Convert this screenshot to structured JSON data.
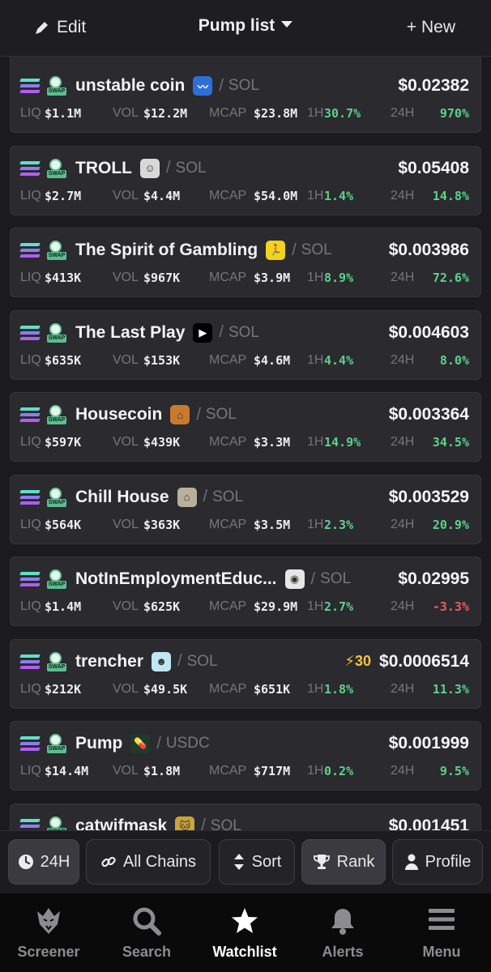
{
  "header": {
    "edit_label": "Edit",
    "title": "Pump list",
    "new_label": "+ New"
  },
  "labels": {
    "liq": "LIQ",
    "vol": "VOL",
    "mcap": "MCAP",
    "h1": "1H",
    "h24": "24H"
  },
  "tokens": [
    {
      "name": "unstable coin",
      "quote": "SOL",
      "price": "$0.02382",
      "liq": "$1.1M",
      "vol": "$12.2M",
      "mcap": "$23.8M",
      "ch1h": "30.7%",
      "ch24h": "970%",
      "logo_bg": "#2d6fd6",
      "logo_glyph": "〰"
    },
    {
      "name": "TROLL",
      "quote": "SOL",
      "price": "$0.05408",
      "liq": "$2.7M",
      "vol": "$4.4M",
      "mcap": "$54.0M",
      "ch1h": "1.4%",
      "ch24h": "14.8%",
      "logo_bg": "#d8d8d8",
      "logo_glyph": "☺"
    },
    {
      "name": "The Spirit of Gambling",
      "quote": "SOL",
      "price": "$0.003986",
      "liq": "$413K",
      "vol": "$967K",
      "mcap": "$3.9M",
      "ch1h": "8.9%",
      "ch24h": "72.6%",
      "logo_bg": "#f3d21a",
      "logo_glyph": "🏃"
    },
    {
      "name": "The Last Play",
      "quote": "SOL",
      "price": "$0.004603",
      "liq": "$635K",
      "vol": "$153K",
      "mcap": "$4.6M",
      "ch1h": "4.4%",
      "ch24h": "8.0%",
      "logo_bg": "#000000",
      "logo_glyph": "▶"
    },
    {
      "name": "Housecoin",
      "quote": "SOL",
      "price": "$0.003364",
      "liq": "$597K",
      "vol": "$439K",
      "mcap": "$3.3M",
      "ch1h": "14.9%",
      "ch24h": "34.5%",
      "logo_bg": "#c97a2e",
      "logo_glyph": "⌂"
    },
    {
      "name": "Chill House",
      "quote": "SOL",
      "price": "$0.003529",
      "liq": "$564K",
      "vol": "$363K",
      "mcap": "$3.5M",
      "ch1h": "2.3%",
      "ch24h": "20.9%",
      "logo_bg": "#b8b09a",
      "logo_glyph": "⌂"
    },
    {
      "name": "NotInEmploymentEduc...",
      "quote": "SOL",
      "price": "$0.02995",
      "liq": "$1.4M",
      "vol": "$625K",
      "mcap": "$29.9M",
      "ch1h": "2.7%",
      "ch24h": "-3.3%",
      "logo_bg": "#e6e6e6",
      "logo_glyph": "◉"
    },
    {
      "name": "trencher",
      "quote": "SOL",
      "price": "$0.0006514",
      "liq": "$212K",
      "vol": "$49.5K",
      "mcap": "$651K",
      "ch1h": "1.8%",
      "ch24h": "11.3%",
      "logo_bg": "#bfe6f5",
      "logo_glyph": "☻",
      "boost": "⚡30"
    },
    {
      "name": "Pump",
      "quote": "USDC",
      "price": "$0.001999",
      "liq": "$14.4M",
      "vol": "$1.8M",
      "mcap": "$717M",
      "ch1h": "0.2%",
      "ch24h": "9.5%",
      "logo_bg": "#1e3a2b",
      "logo_glyph": "💊"
    },
    {
      "name": "catwifmask",
      "quote": "SOL",
      "price": "$0.001451",
      "liq": "",
      "vol": "",
      "mcap": "",
      "ch1h": "",
      "ch24h": "",
      "logo_bg": "#c9a43a",
      "logo_glyph": "🐱"
    }
  ],
  "filters": {
    "time": "24H",
    "chains": "All Chains",
    "sort": "Sort",
    "rank": "Rank",
    "profile": "Profile"
  },
  "nav": {
    "screener": "Screener",
    "search": "Search",
    "watchlist": "Watchlist",
    "alerts": "Alerts",
    "menu": "Menu"
  },
  "colors": {
    "positive": "#5dd28a",
    "negative": "#ef5b5b",
    "background": "#1b1b1f",
    "card": "#2a2a2f"
  }
}
